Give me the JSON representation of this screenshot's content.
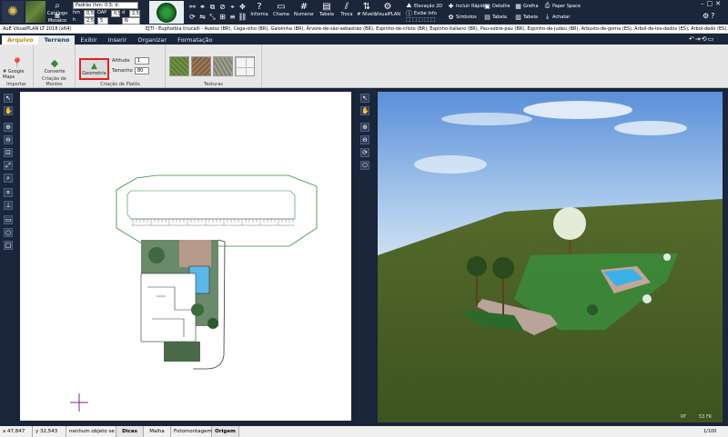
{
  "toolbar": {
    "catalogo": "Catálogo",
    "mosaico": "Mosaico",
    "pattern_select": "Padrão (hm: 0,5; d:",
    "hm_label": "hm",
    "hm_value": "0,5",
    "dap_label": "DAP",
    "d_label": "d",
    "d_value": "2,5",
    "h_label": "h",
    "h_value": "2,5",
    "value5": "5",
    "n_value": "N",
    "value1": "1",
    "value03": "0,5",
    "informa": "Informa",
    "chama": "Chama",
    "numerar": "Numerar",
    "tabela": "Tabela",
    "troca": "Troca",
    "nivelo": "# Nívelo",
    "visualplan": "VisualPLAN",
    "elevacao2d": "Elevação 2D",
    "exibe_info": "Exibe Info",
    "simbolos": "Símbolos",
    "incluir_rapido": "Incluir Rápido",
    "detalhe": "Detalhe",
    "tabela2": "Tabela",
    "grelha": "Grelha",
    "paper_space": "Paper Space",
    "acharar": "Achatar",
    "zoom": "1/100",
    "rt_symbol": "RT"
  },
  "window": {
    "title": "AuE VisualPLAN LT 2018 (x64)",
    "species_list": "EJTI - Euphorbia tirucalli - Aveloz (BR), Cega-olho (BR), Gaiolinha (BR), Árvore-de-são-sebastião (BR), Espinho-de-cristo (BR), Espinho-italiano (BR), Pau-sobre-pau (BR), Espinho-de-judeu (BR), Arbusto-de-goma (ES), Árbol-de-los-dedos (ES), Árbol-dedo (ES), Arbusto-de-leche (ES), Palitroque"
  },
  "menu": {
    "arquivo": "Arquivo",
    "terreno": "Terreno",
    "exibir": "Exibir",
    "inserir": "Inserir",
    "organizar": "Organizar",
    "formatacao": "Formatação"
  },
  "ribbon": {
    "google_maps": "# Google Maps",
    "importar": "Importar",
    "converte": "Converte",
    "criacao_montes": "Criação de Montes",
    "geometria": "Geometria",
    "altitude_label": "Altitude",
    "altitude_value": "1",
    "tamanho_label": "Tamanho",
    "tamanho_value": "80",
    "criacao_platos": "Criação de Platôs",
    "texturas": "Texturas"
  },
  "status": {
    "x": "x 47,847",
    "y": "y 32,543",
    "selection": "nenhum objeto se",
    "dicas": "Dicas",
    "malha": "Malha",
    "fotomontagem": "Fotomontagem",
    "origem": "Origem"
  },
  "view3d": {
    "rt": "RT",
    "fps": "53 FK"
  },
  "colors": {
    "accent_red": "#e02020",
    "panel_dark": "#1b263a",
    "ribbon_bg": "#e7e7e7",
    "plan_outline": "#2e8b3a"
  }
}
